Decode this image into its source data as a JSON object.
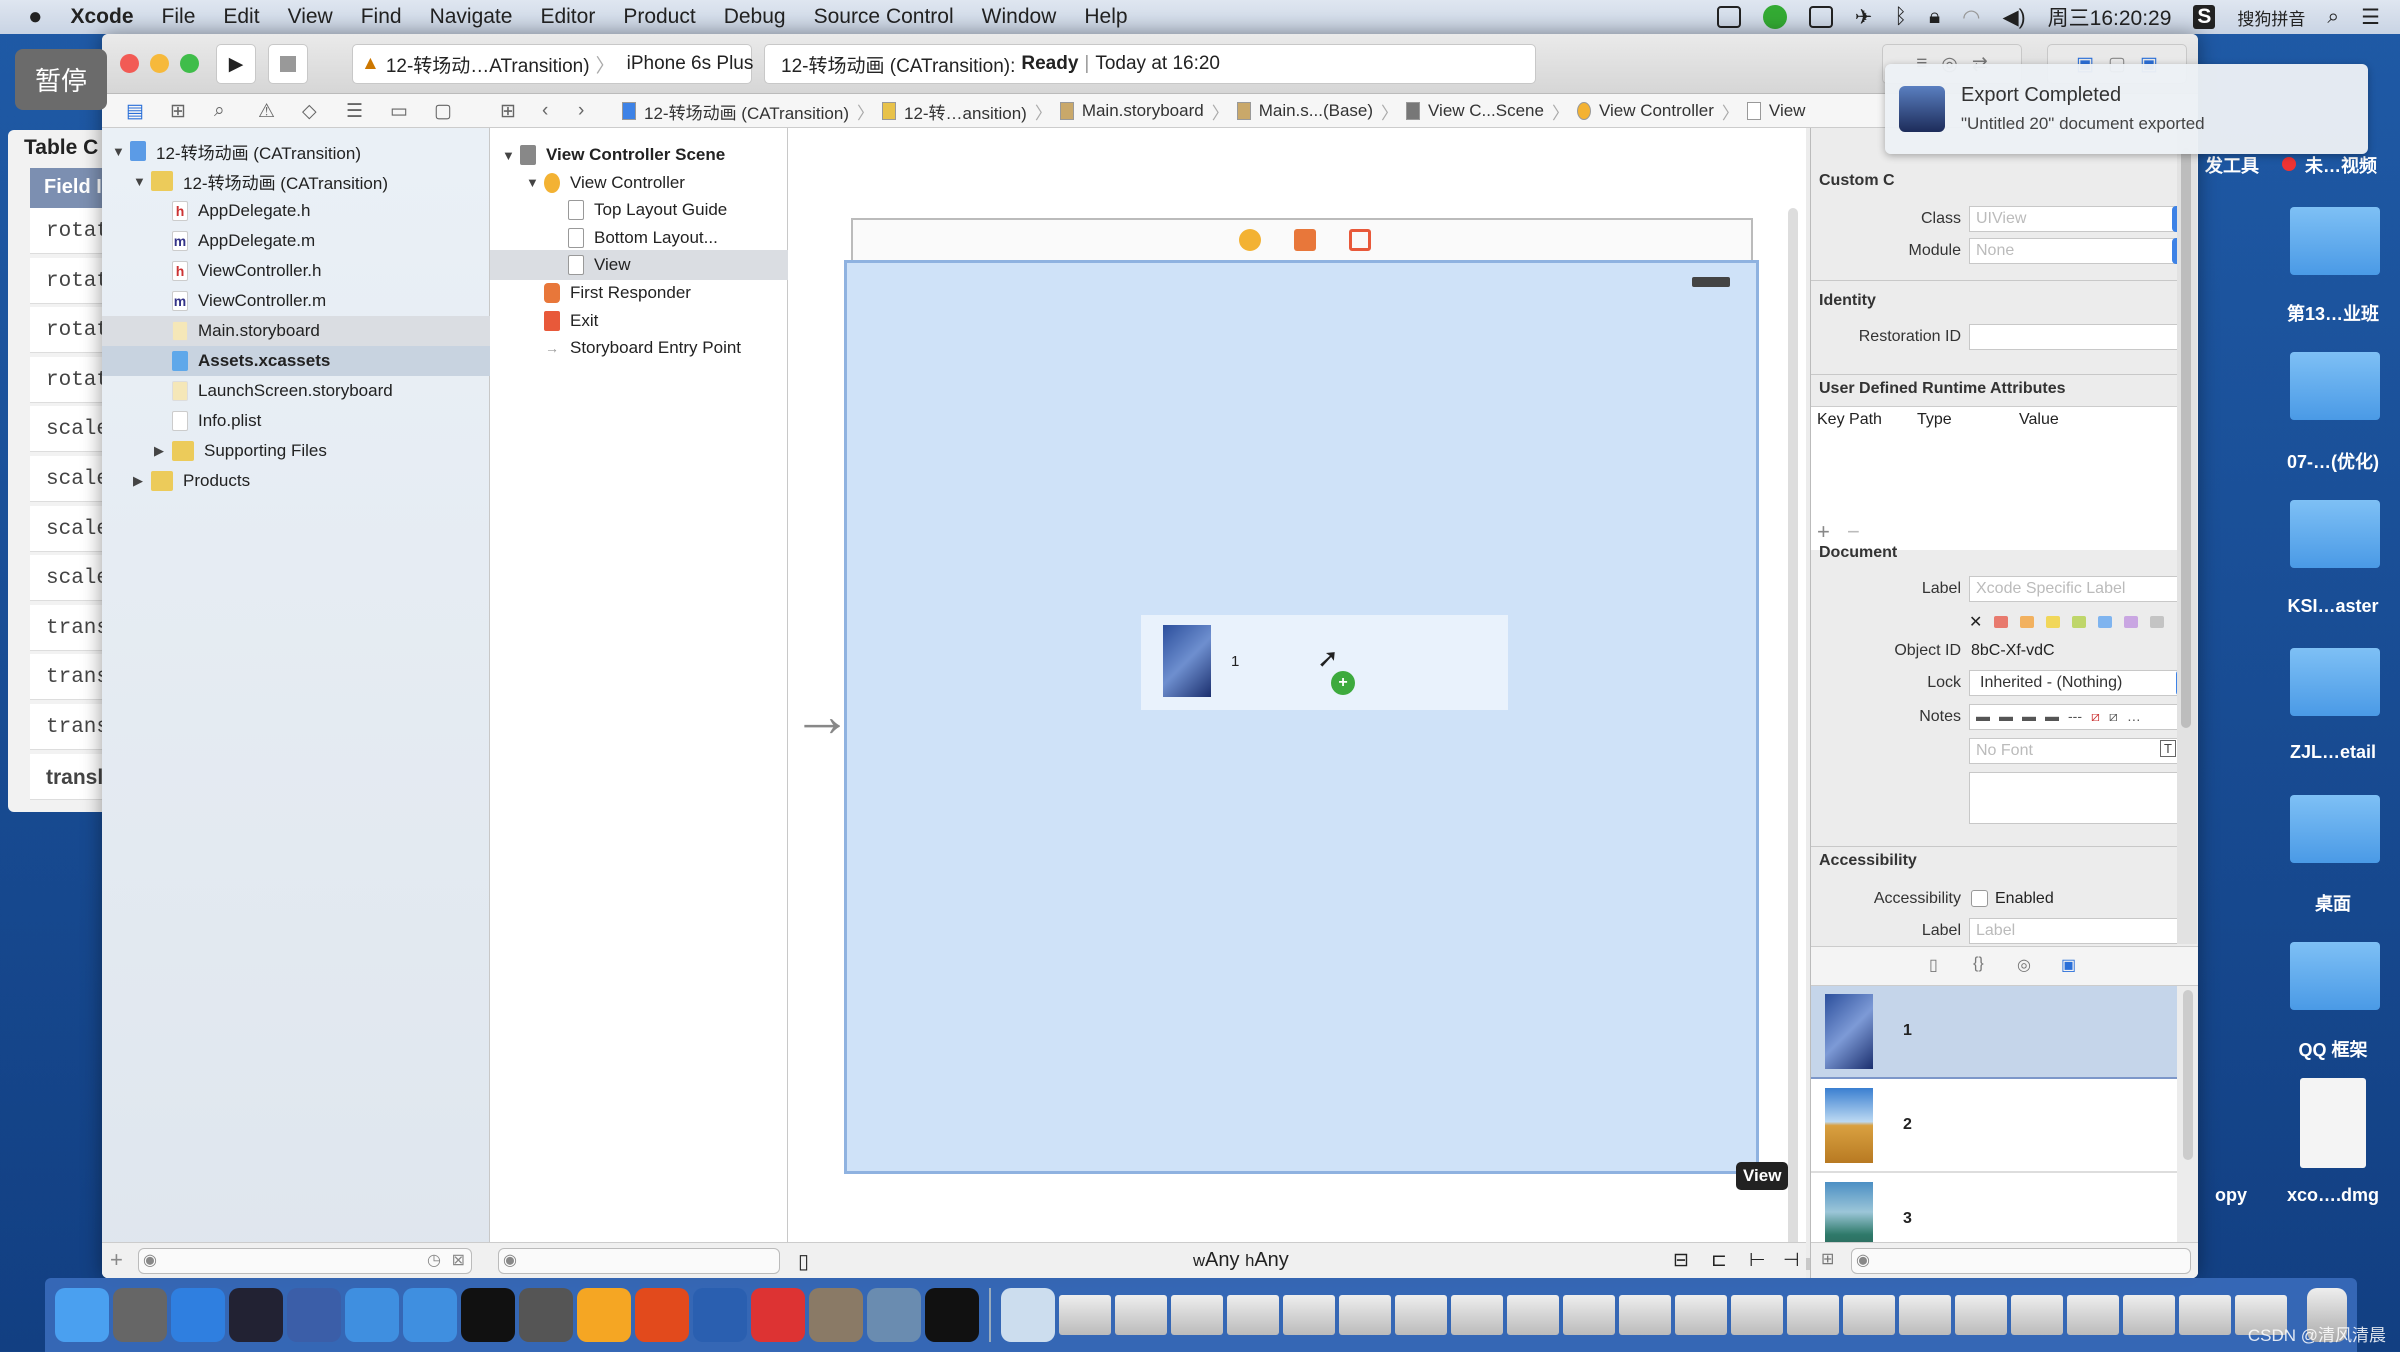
{
  "menubar": {
    "apple": "",
    "items": [
      "Xcode",
      "File",
      "Edit",
      "View",
      "Find",
      "Navigate",
      "Editor",
      "Product",
      "Debug",
      "Source Control",
      "Window",
      "Help"
    ],
    "clock": "周三16:20:29",
    "ime": "搜狗拼音"
  },
  "overlay": {
    "pause": "暂停"
  },
  "background_window": {
    "title": "Table C",
    "header": "Field I",
    "rows": [
      "rotat",
      "rotat",
      "rotat",
      "rotat",
      "scale",
      "scale",
      "scale",
      "scale",
      "trans",
      "trans",
      "trans",
      "transla"
    ]
  },
  "toolbar": {
    "scheme": "12-转场动…ATransition)",
    "device": "iPhone 6s Plus",
    "status_project": "12-转场动画 (CATransition):",
    "status_state": "Ready",
    "status_time": "Today at 16:20"
  },
  "breadcrumbs": [
    "12-转场动画 (CATransition)",
    "12-转…ansition)",
    "Main.storyboard",
    "Main.s...(Base)",
    "View C...Scene",
    "View Controller",
    "View"
  ],
  "navigator": {
    "items": [
      {
        "label": "12-转场动画 (CATransition)",
        "icon": "project-icon",
        "level": 0,
        "arrow": "▼"
      },
      {
        "label": "12-转场动画 (CATransition)",
        "icon": "folder-icon",
        "level": 1,
        "arrow": "▼"
      },
      {
        "label": "AppDelegate.h",
        "icon": "h",
        "level": 2
      },
      {
        "label": "AppDelegate.m",
        "icon": "m",
        "level": 2
      },
      {
        "label": "ViewController.h",
        "icon": "h",
        "level": 2
      },
      {
        "label": "ViewController.m",
        "icon": "m",
        "level": 2
      },
      {
        "label": "Main.storyboard",
        "icon": "storyboard-icon",
        "level": 2,
        "state": "hover"
      },
      {
        "label": "Assets.xcassets",
        "icon": "assets-icon",
        "level": 2,
        "state": "selected"
      },
      {
        "label": "LaunchScreen.storyboard",
        "icon": "storyboard-icon",
        "level": 2
      },
      {
        "label": "Info.plist",
        "icon": "plist-icon",
        "level": 2
      },
      {
        "label": "Supporting Files",
        "icon": "folder-icon",
        "level": 2,
        "arrow": "▶"
      },
      {
        "label": "Products",
        "icon": "folder-icon",
        "level": 1,
        "arrow": "▶"
      }
    ]
  },
  "outline": {
    "items": [
      {
        "label": "View Controller Scene",
        "level": 0,
        "arrow": "▼",
        "bold": true,
        "icon": "scene-icon"
      },
      {
        "label": "View Controller",
        "level": 1,
        "arrow": "▼",
        "icon": "view-controller-icon"
      },
      {
        "label": "Top Layout Guide",
        "level": 2,
        "icon": "layout-guide-icon"
      },
      {
        "label": "Bottom Layout...",
        "level": 2,
        "icon": "layout-guide-icon"
      },
      {
        "label": "View",
        "level": 2,
        "icon": "view-icon",
        "selected": true
      },
      {
        "label": "First Responder",
        "level": 1,
        "icon": "first-responder-icon"
      },
      {
        "label": "Exit",
        "level": 1,
        "icon": "exit-icon"
      },
      {
        "label": "Storyboard Entry Point",
        "level": 1,
        "icon": "entry-arrow-icon"
      }
    ]
  },
  "canvas": {
    "drag_label": "1",
    "view_tag": "View",
    "size_class_w": "w",
    "size_class_w_val": "Any",
    "size_class_h": "h",
    "size_class_h_val": "Any",
    "view_bg": "#cfe2f8"
  },
  "inspector": {
    "custom_class": "Custom C",
    "class_label": "Class",
    "class_placeholder": "UIView",
    "module_label": "Module",
    "module_placeholder": "None",
    "identity": "Identity",
    "restoration_label": "Restoration ID",
    "udra": "User Defined Runtime Attributes",
    "columns": [
      "Key Path",
      "Type",
      "Value"
    ],
    "document": "Document",
    "label_label": "Label",
    "label_placeholder": "Xcode Specific Label",
    "label_colors": [
      "#e87a6e",
      "#f2b15f",
      "#f1d75a",
      "#bfd66a",
      "#7fb4ef",
      "#c9a6e2",
      "#c4c4c4"
    ],
    "objectid_label": "Object ID",
    "objectid": "8bC-Xf-vdC",
    "lock_label": "Lock",
    "lock_value": "Inherited - (Nothing)",
    "notes_label": "Notes",
    "font_placeholder": "No Font",
    "accessibility": "Accessibility",
    "acc_label": "Accessibility",
    "acc_enabled": "Enabled",
    "acc_enabled_checked": false,
    "acc_label2": "Label",
    "acc_label_placeholder": "Label"
  },
  "library": {
    "items": [
      {
        "label": "1",
        "selected": true
      },
      {
        "label": "2"
      },
      {
        "label": "3"
      }
    ]
  },
  "notification": {
    "title": "Export Completed",
    "body": "\"Untitled 20\" document exported"
  },
  "desktop": {
    "top_labels": [
      "发工具",
      "未…视频"
    ],
    "labels": [
      "第13…业班",
      "07-…(优化)",
      "KSI…aster",
      "ZJL…etail",
      "桌面",
      "QQ 框架",
      "xco….dmg"
    ],
    "partial": "opy"
  },
  "watermark": "CSDN @清风清晨"
}
